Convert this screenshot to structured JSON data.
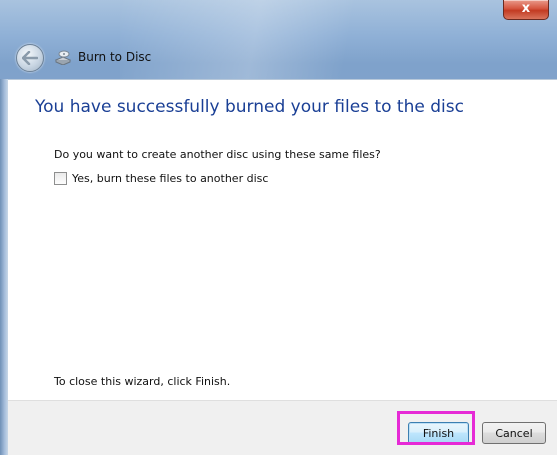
{
  "window": {
    "title": "Burn to Disc",
    "close_glyph": "x"
  },
  "main": {
    "heading": "You have successfully burned your files to the disc",
    "question": "Do you want to create another disc using these same files?",
    "checkbox_label": "Yes, burn these files to another disc",
    "checkbox_checked": false,
    "close_hint": "To close this wizard, click Finish."
  },
  "footer": {
    "finish_label": "Finish",
    "cancel_label": "Cancel"
  },
  "icons": {
    "back": "back-arrow-icon",
    "title": "disc-burn-icon"
  },
  "colors": {
    "heading": "#1a3f95",
    "highlight": "#e62ad6"
  }
}
